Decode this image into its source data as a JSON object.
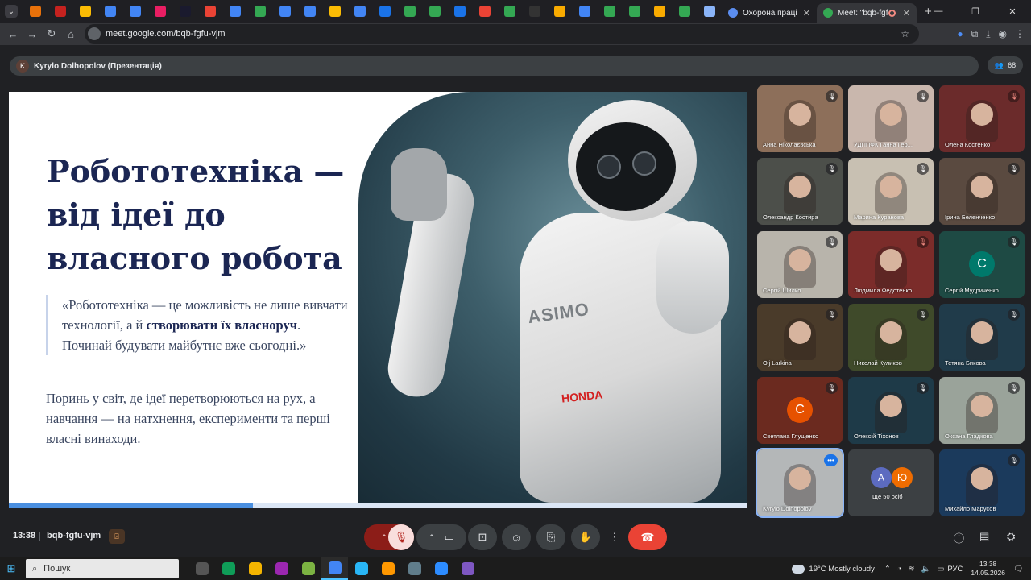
{
  "browser": {
    "tabs": [
      {
        "title": "Охорона праці",
        "active": false
      },
      {
        "title": "Meet: \"bqb-fgfu-",
        "active": true
      }
    ],
    "url": "meet.google.com/bqb-fgfu-vjm"
  },
  "meet": {
    "presenter_label": "Kyrylo Dolhopolov (Презентація)",
    "presenter_initial": "K",
    "participant_count": "68",
    "time": "13:38",
    "meeting_code": "bqb-fgfu-vjm",
    "more_label": "Ще 50 осіб",
    "more_initials": [
      "А",
      "Ю"
    ]
  },
  "slide": {
    "title_lines": [
      "Робототехніка —",
      "від ідеї до",
      "власного робота"
    ],
    "quote_prefix": "«Робототехніка — це можливість не лише вивчати технології, а й ",
    "quote_bold": "створювати їх власноруч",
    "quote_suffix": ". Починай будувати майбутнє вже сьогодні.»",
    "body": "Поринь у світ, де ідеї перетворюються на рух, а навчання — на натхнення, експерименти та перші власні винаходи.",
    "robot_brand": "HONDA",
    "robot_model": "ASIMO",
    "progress": 0.33
  },
  "participants": [
    {
      "name": "Анна Ніколаєвська",
      "bg": "#8d6f5a",
      "muted_red": false
    },
    {
      "name": "УДППФК Ганна Гер...",
      "bg": "#c9b7ad",
      "muted_red": false
    },
    {
      "name": "Олена Костенко",
      "bg": "#6b2b2b",
      "muted_red": true
    },
    {
      "name": "Олександр Костира",
      "bg": "#4c4f4a",
      "muted_red": false
    },
    {
      "name": "Марина Куранова",
      "bg": "#c8c0b2",
      "muted_red": false
    },
    {
      "name": "Ірина Беленченко",
      "bg": "#5a4a40",
      "muted_red": false
    },
    {
      "name": "Сергій Шилко",
      "bg": "#b8b4ab",
      "muted_red": false
    },
    {
      "name": "Людмила Федотенко",
      "bg": "#7b2c2a",
      "muted_red": true
    },
    {
      "name": "Сергій Мудриченко",
      "bg": "#1e4a44",
      "initial": "С",
      "initial_bg": "#00796b"
    },
    {
      "name": "Olj Larkina",
      "bg": "#4a3b2a",
      "muted_red": false
    },
    {
      "name": "Николай Куликов",
      "bg": "#3f4a2a",
      "muted_red": false
    },
    {
      "name": "Тетяна Бикова",
      "bg": "#203b4a",
      "muted_red": false
    },
    {
      "name": "Светлана Глущенко",
      "bg": "#6b2a1f",
      "initial": "С",
      "initial_bg": "#e65100"
    },
    {
      "name": "Олексій Тіхонов",
      "bg": "#1e3a48",
      "muted_red": false
    },
    {
      "name": "Оксана Гладкова",
      "bg": "#9aa39a",
      "muted_red": false
    },
    {
      "name": "Kyrylo Dolhopolov",
      "bg": "#b4b7b8",
      "speaking": true
    },
    {
      "name": "",
      "bg": "#3c4043",
      "more": true
    },
    {
      "name": "Михайло Марусов",
      "bg": "#1b3a5c",
      "muted_red": false
    }
  ],
  "taskbar": {
    "search_placeholder": "Пошук",
    "weather": "19°C  Mostly cloudy",
    "lang": "РУС",
    "clock_time": "13:38",
    "clock_date": "14.05.2026"
  }
}
